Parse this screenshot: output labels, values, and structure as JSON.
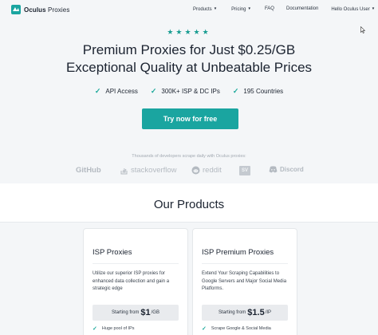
{
  "header": {
    "logo": {
      "name": "Oculus",
      "accent": "Proxies",
      "icon": "oculus-logo-icon"
    },
    "nav": [
      {
        "label": "Products",
        "dropdown": true
      },
      {
        "label": "Pricing",
        "dropdown": true
      },
      {
        "label": "FAQ",
        "dropdown": false
      },
      {
        "label": "Documentation",
        "dropdown": false
      },
      {
        "label": "Hello Oculus User",
        "dropdown": true
      }
    ]
  },
  "hero": {
    "rating_stars": 5,
    "stars": "★★★★★",
    "headline_line1": "Premium Proxies for Just $0.25/GB",
    "headline_line2": "Exceptional Quality at Unbeatable Prices",
    "features": [
      "API Access",
      "300K+ ISP & DC IPs",
      "195 Countries"
    ],
    "cta_label": "Try now for free"
  },
  "trust": {
    "caption": "Thousands of developers scrape daily with Oculus proxies:",
    "brands": [
      "GitHub",
      "stackoverflow",
      "reddit",
      "SV",
      "Discord"
    ]
  },
  "products": {
    "title": "Our Products",
    "cards": [
      {
        "title": "ISP Proxies",
        "description": "Utilize our superior ISP proxies for enhanced data collection and gain a strategic edge",
        "price_prefix": "Starting from",
        "price": "$1",
        "price_unit": "/GB",
        "feature": "Huge pool of IPs"
      },
      {
        "title": "ISP Premium Proxies",
        "description": "Extend Your Scraping Capabilities to Google Servers and Major Social Media Platforms.",
        "price_prefix": "Starting from",
        "price": "$1.5",
        "price_unit": "/IP",
        "feature": "Scrape Google & Social Media"
      }
    ]
  },
  "colors": {
    "accent": "#1aa5a0",
    "text": "#1b2330",
    "muted": "#a2a9b1"
  }
}
